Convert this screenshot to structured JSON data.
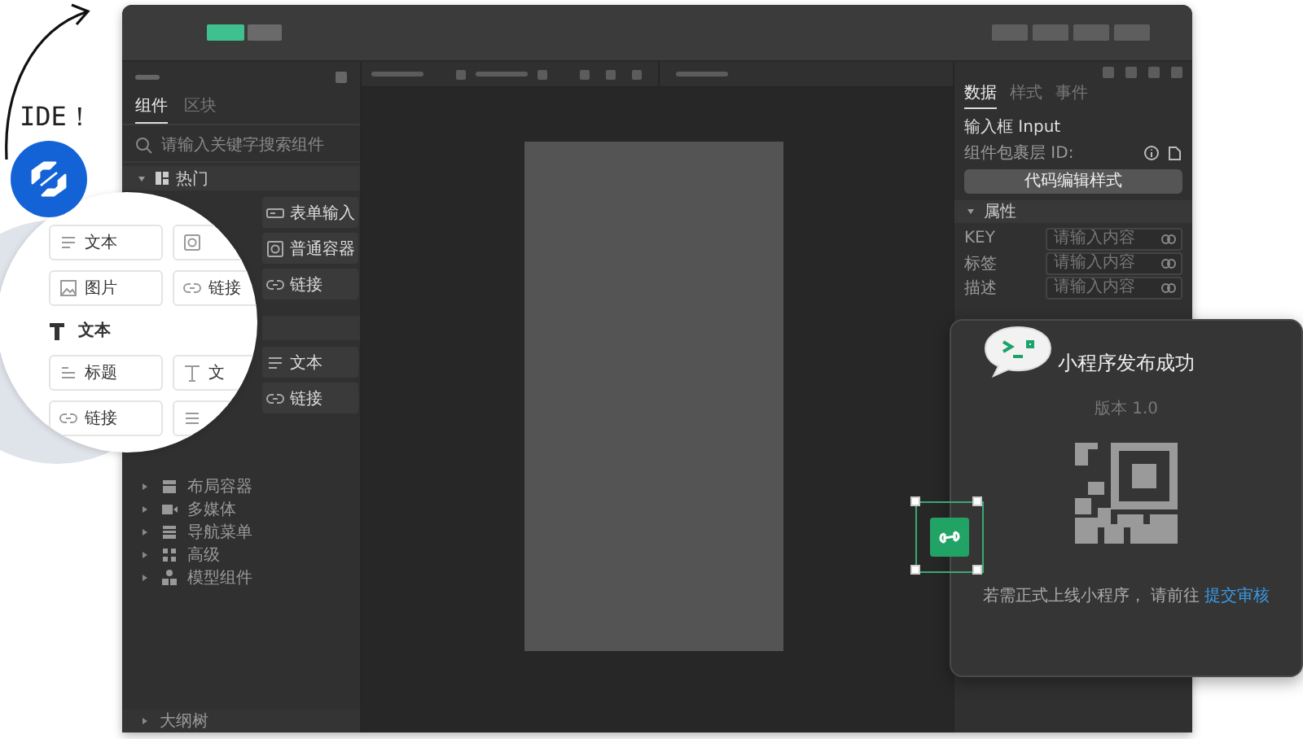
{
  "annotation": {
    "label": "IDE！"
  },
  "left_panel": {
    "tabs": [
      {
        "label": "组件",
        "selected": true
      },
      {
        "label": "区块",
        "selected": false
      }
    ],
    "search": {
      "placeholder": "请输入关键字搜索组件"
    },
    "hot_section": {
      "title": "热门",
      "expanded": true
    },
    "hot_items": [
      {
        "label": "表单输入",
        "kind": "input"
      },
      {
        "label": "普通容器",
        "kind": "container"
      },
      {
        "label": "链接",
        "kind": "link"
      }
    ],
    "text_items": [
      {
        "label": "文本",
        "kind": "text"
      },
      {
        "label": "链接",
        "kind": "link"
      }
    ],
    "categories": [
      {
        "label": "布局容器",
        "kind": "layout",
        "expanded": false
      },
      {
        "label": "多媒体",
        "kind": "media",
        "expanded": false
      },
      {
        "label": "导航菜单",
        "kind": "nav",
        "expanded": false
      },
      {
        "label": "高级",
        "kind": "advanced",
        "expanded": false
      },
      {
        "label": "模型组件",
        "kind": "model",
        "expanded": false
      }
    ],
    "outline": {
      "label": "大纲树",
      "expanded": false
    }
  },
  "right_panel": {
    "tabs": [
      {
        "label": "数据",
        "selected": true
      },
      {
        "label": "样式",
        "selected": false
      },
      {
        "label": "事件",
        "selected": false
      }
    ],
    "component_title": "输入框 Input",
    "wrapper_id_label": "组件包裹层 ID:",
    "code_button": "代码编辑样式",
    "section": {
      "title": "属性",
      "expanded": true
    },
    "fields": [
      {
        "label": "KEY",
        "placeholder": "请输入内容"
      },
      {
        "label": "标签",
        "placeholder": "请输入内容"
      },
      {
        "label": "描述",
        "placeholder": "请输入内容"
      }
    ]
  },
  "publish_dialog": {
    "title": "小程序发布成功",
    "version": "版本 1.0",
    "note": "若需正式上线小程序， 请前往",
    "link": "提交审核"
  },
  "magnifier": {
    "items": [
      {
        "label": "文本",
        "kind": "text"
      },
      {
        "kind": "container"
      },
      {
        "label": "图片",
        "kind": "image"
      },
      {
        "label": "链接",
        "kind": "link"
      }
    ],
    "section": {
      "title": "文本"
    },
    "section_items": [
      {
        "label": "标题",
        "kind": "heading"
      },
      {
        "label": "文",
        "kind": "letter"
      },
      {
        "label": "链接",
        "kind": "link"
      },
      {
        "kind": "list"
      }
    ]
  }
}
